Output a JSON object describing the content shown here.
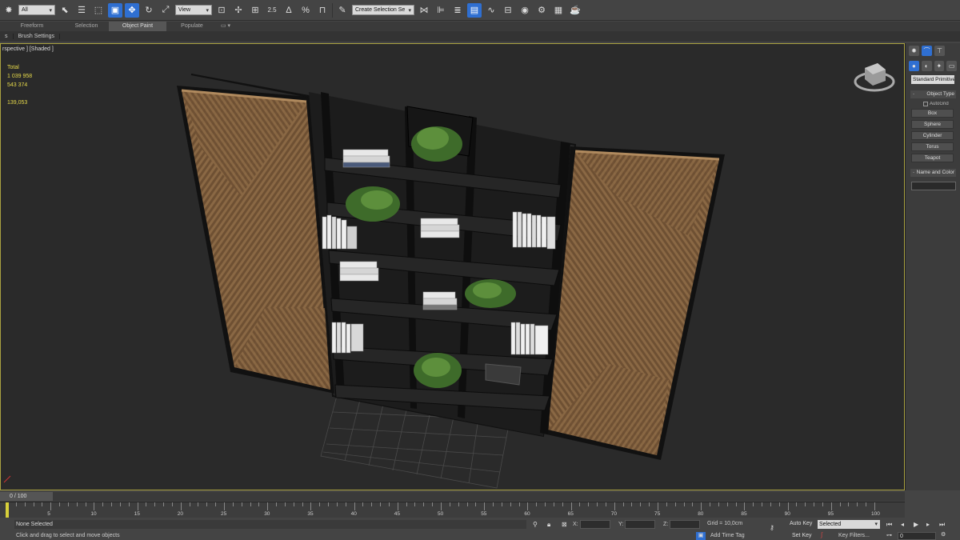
{
  "toolbar": {
    "filter_value": "All",
    "refcoord_value": "View",
    "snaps_label": "2.5",
    "angle_pct": "%",
    "selset_placeholder": "Create Selection Se"
  },
  "ribbon": {
    "tabs": [
      "Freeform",
      "Selection",
      "Object Paint",
      "Populate"
    ],
    "active_tab": "Object Paint",
    "subpanel": [
      "s",
      "Brush Settings"
    ]
  },
  "viewport": {
    "label": "rspective ] [Shaded ]",
    "stats": {
      "total_label": "Total",
      "polys": "1 039 958",
      "verts": "543 374",
      "fps": "139,053"
    }
  },
  "command_panel": {
    "dropdown": "Standard Primitives",
    "rollout_object_type": "Object Type",
    "autogrid": "AutoGrid",
    "buttons": [
      "Box",
      "Sphere",
      "Cylinder",
      "Torus",
      "Teapot"
    ],
    "rollout_name": "Name and Color"
  },
  "timeline": {
    "position": "0 / 100",
    "ticks": [
      "5",
      "10",
      "15",
      "20",
      "25",
      "30",
      "35",
      "40",
      "45",
      "50",
      "55",
      "60",
      "65",
      "70",
      "75",
      "80",
      "85",
      "90",
      "95",
      "100"
    ]
  },
  "status": {
    "selection": "None Selected",
    "prompt": "Click and drag to select and move objects",
    "x_label": "X:",
    "y_label": "Y:",
    "z_label": "Z:",
    "grid": "Grid = 10,0cm",
    "add_time_tag": "Add Time Tag",
    "auto_key": "Auto Key",
    "set_key": "Set Key",
    "key_mode": "Selected",
    "key_filters": "Key Filters...",
    "frame": "0"
  },
  "colors": {
    "accent": "#2f6fd1",
    "viewport_border": "#a8a040",
    "stats": "#e6d94a",
    "wood": "#7a5a3a"
  }
}
